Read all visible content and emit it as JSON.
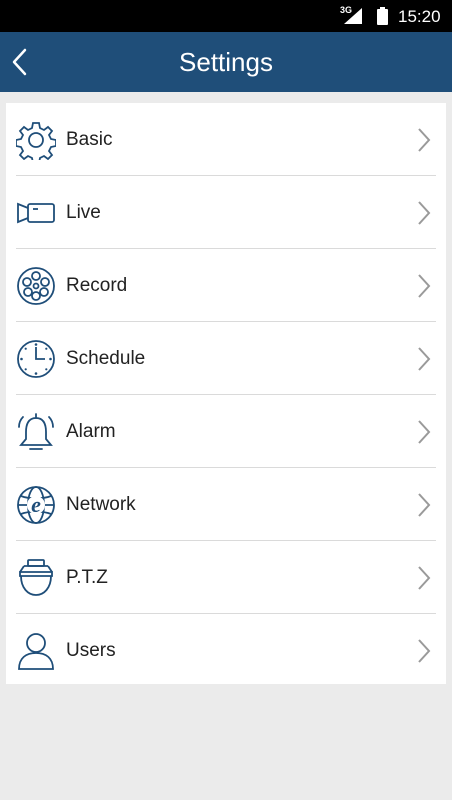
{
  "status_bar": {
    "network": "3G",
    "time": "15:20",
    "signal_icon": "signal-icon",
    "battery_icon": "battery-icon"
  },
  "header": {
    "title": "Settings",
    "back_icon": "back-arrow-icon"
  },
  "colors": {
    "header": "#1f4e79",
    "icon": "#1f4e79",
    "background": "#ebebeb",
    "panel": "#ffffff"
  },
  "menu": {
    "items": [
      {
        "label": "Basic",
        "icon": "gear-icon"
      },
      {
        "label": "Live",
        "icon": "camera-icon"
      },
      {
        "label": "Record",
        "icon": "film-reel-icon"
      },
      {
        "label": "Schedule",
        "icon": "clock-icon"
      },
      {
        "label": "Alarm",
        "icon": "bell-icon"
      },
      {
        "label": "Network",
        "icon": "globe-icon"
      },
      {
        "label": "P.T.Z",
        "icon": "dome-camera-icon"
      },
      {
        "label": "Users",
        "icon": "user-icon"
      }
    ]
  }
}
